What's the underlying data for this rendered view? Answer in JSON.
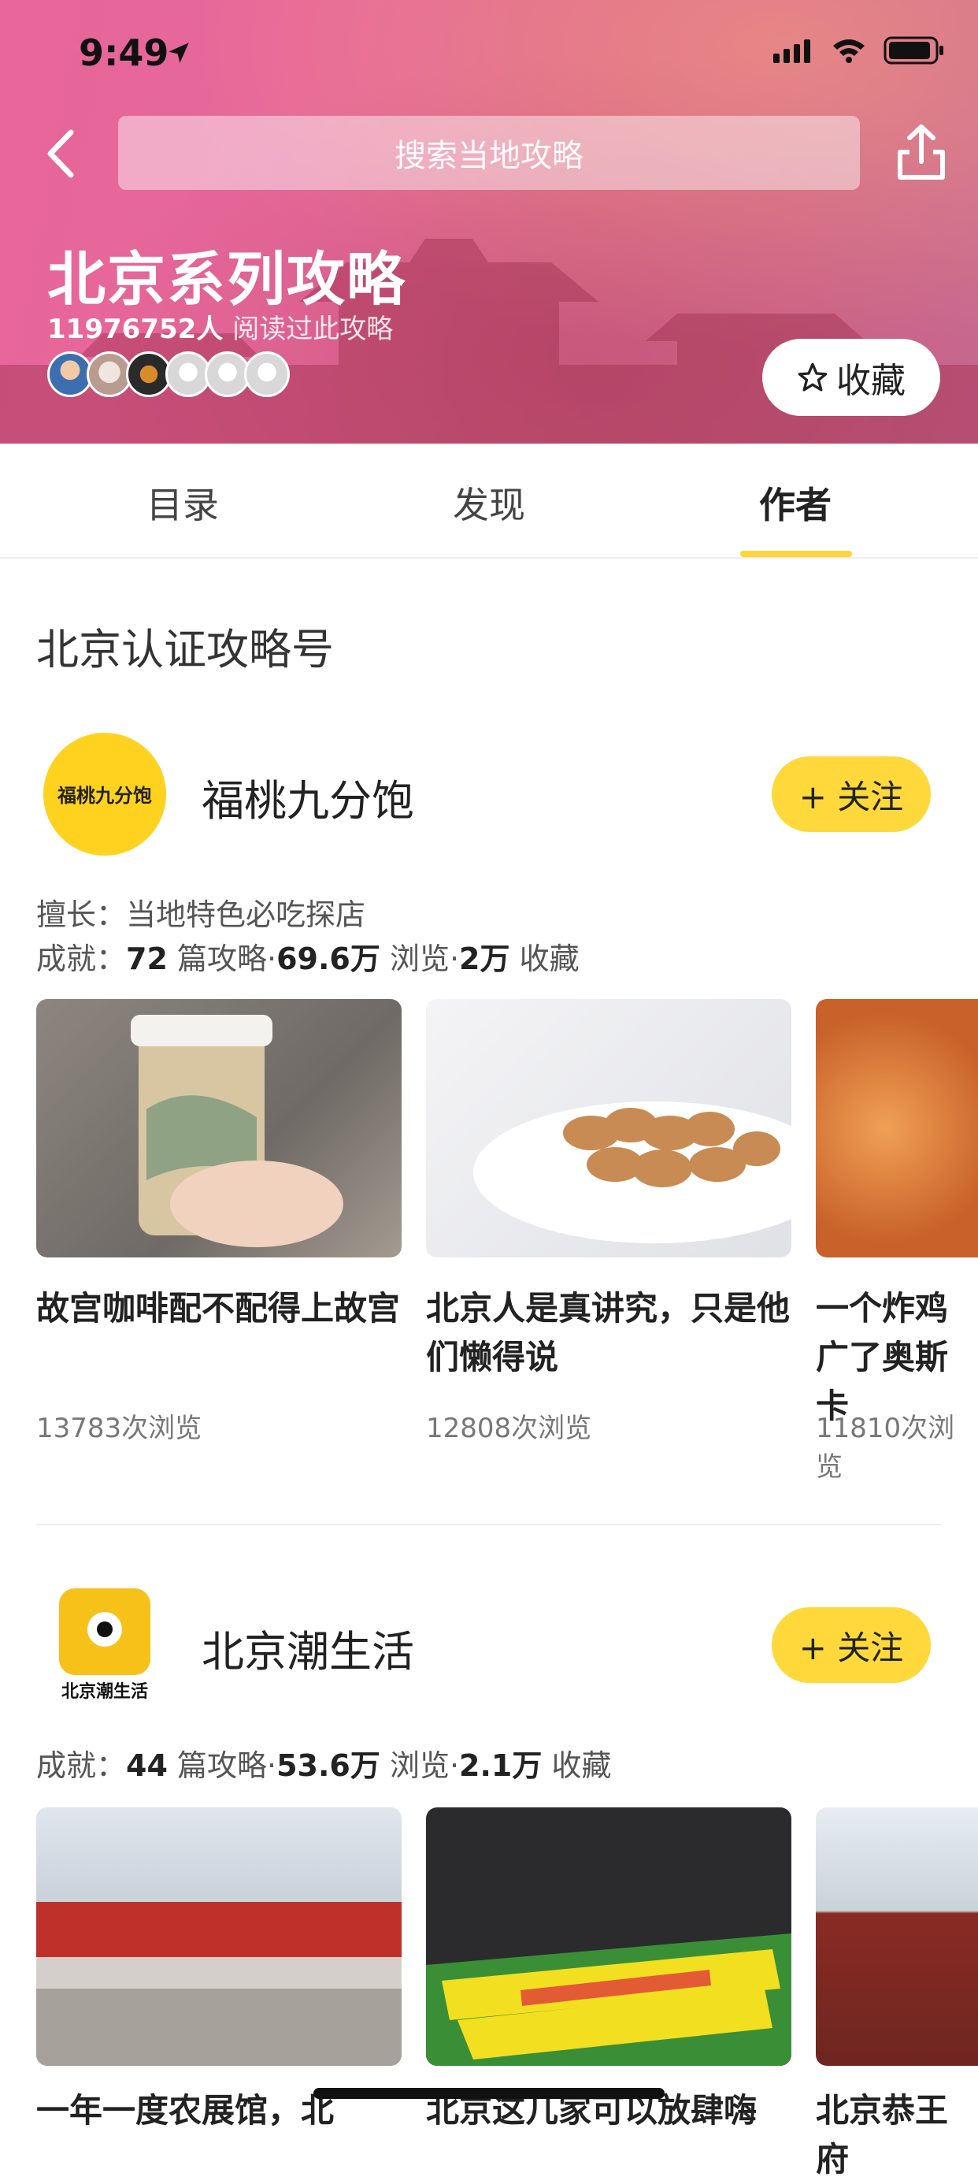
{
  "status": {
    "time": "9:49"
  },
  "header": {
    "search_placeholder": "搜索当地攻略",
    "title": "北京系列攻略",
    "read_count": "11976752人",
    "read_label": "阅读过此攻略",
    "favorite_label": "收藏"
  },
  "tabs": [
    {
      "label": "目录",
      "active": false
    },
    {
      "label": "发现",
      "active": false
    },
    {
      "label": "作者",
      "active": true
    }
  ],
  "section_title": "北京认证攻略号",
  "authors": [
    {
      "name": "福桃九分饱",
      "follow_label": "+ 关注",
      "specialty_label": "擅长：",
      "specialty": "当地特色必吃探店",
      "achv_label": "成就：",
      "achv_guides": "72",
      "achv_guides_unit": "篇攻略·",
      "achv_views": "69.6万",
      "achv_views_unit": "浏览·",
      "achv_favs": "2万",
      "achv_favs_unit": "收藏",
      "cards": [
        {
          "title": "故宫咖啡配不配得上故宫",
          "views": "13783次浏览"
        },
        {
          "title": "北京人是真讲究，只是他们懒得说",
          "views": "12808次浏览"
        },
        {
          "title": "一个炸鸡广了奥斯卡",
          "views": "11810次浏览"
        }
      ]
    },
    {
      "name": "北京潮生活",
      "follow_label": "+ 关注",
      "achv_label": "成就：",
      "achv_guides": "44",
      "achv_guides_unit": "篇攻略·",
      "achv_views": "53.6万",
      "achv_views_unit": "浏览·",
      "achv_favs": "2.1万",
      "achv_favs_unit": "收藏",
      "cards": [
        {
          "title": "一年一度农展馆，北",
          "views": ""
        },
        {
          "title": "北京这几家可以放肆嗨",
          "views": ""
        },
        {
          "title": "北京恭王府",
          "views": ""
        }
      ]
    }
  ],
  "logo_texts": {
    "a": "福桃九分饱",
    "b": "北京潮生活"
  },
  "colors": {
    "accent_yellow": "#ffd93b",
    "header_pink": "#e5689a"
  }
}
